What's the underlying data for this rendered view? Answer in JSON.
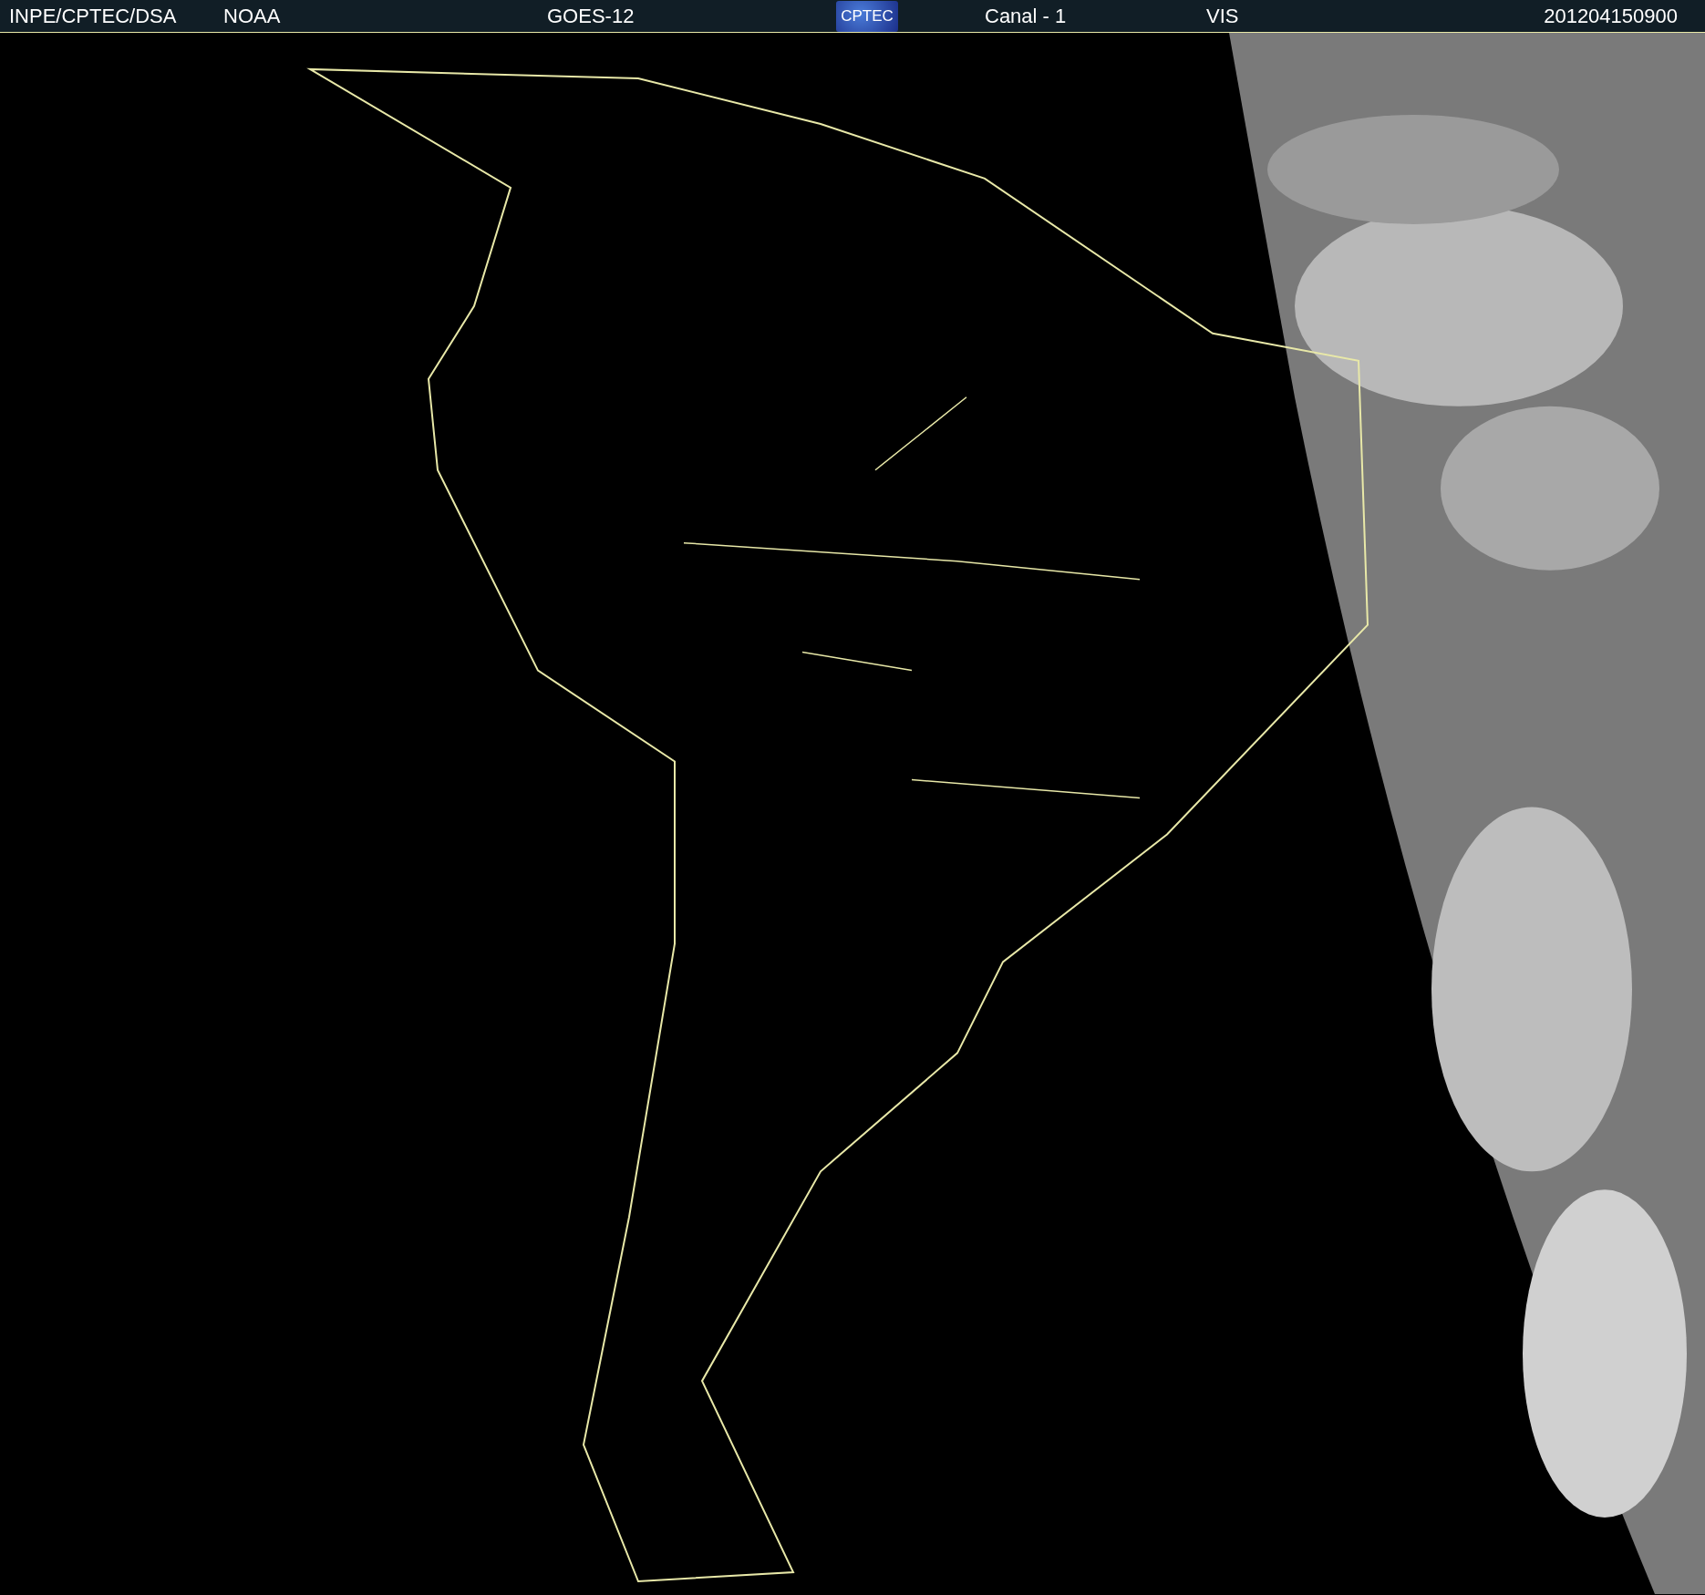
{
  "header": {
    "items": [
      {
        "kind": "text",
        "text": "INPE/CPTEC/DSA"
      },
      {
        "kind": "text",
        "text": "NOAA"
      },
      {
        "kind": "text",
        "text": "GOES-12"
      },
      {
        "kind": "logo",
        "text": "CPTEC"
      },
      {
        "kind": "text",
        "text": "Canal - 1"
      },
      {
        "kind": "text",
        "text": "VIS"
      },
      {
        "kind": "text",
        "text": "201204150900"
      }
    ]
  }
}
